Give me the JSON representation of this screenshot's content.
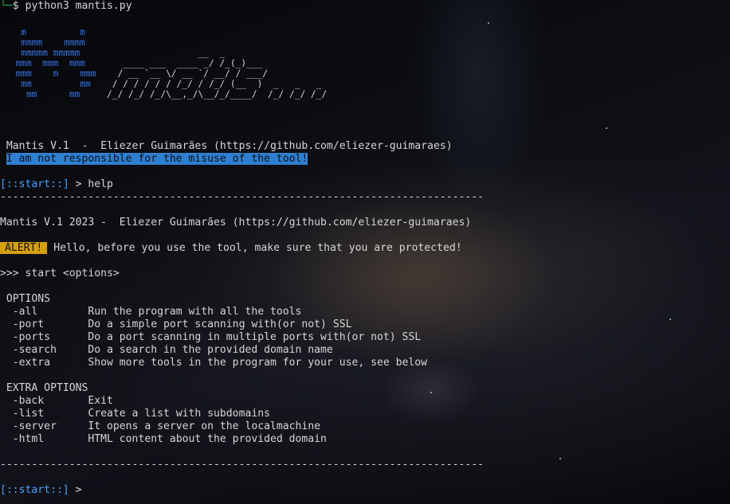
{
  "colors": {
    "background": "#07090d",
    "text": "#d6d6d6",
    "prompt_accent": "#3aa34a",
    "prompt_bracket": "#4a9eff",
    "disclaimer_highlight": "#2f7fd0",
    "alert_badge": "#d4a012",
    "logo_blue": "#3a70e0"
  },
  "command": {
    "prefix": "$ ",
    "text": "python3 mantis.py"
  },
  "banner": {
    "logo_rows": [
      "   m          m",
      "   mmmm    mmmm",
      "   mmmmm mmmmm",
      "  mmm  mmm  mmm",
      "  mmm    m    mmm",
      "   mm         mm",
      "    mm      mm"
    ],
    "text_rows": [
      "",
      "",
      "                 __  _",
      "   ____ ___  ____ _/ /_(_)___",
      "  / __ `__ \\/ __ `/ __/ / ___/",
      " / / / / / / /_/ / /_/ (__  )  _   _   _",
      "/_/ /_/ /_/\\__,_/\\__/_/____/  /_/ /_/ /_/"
    ]
  },
  "header": {
    "version_line": "Mantis V.1  -  Eliezer Guimarães (https://github.com/eliezer-guimaraes)",
    "disclaimer": "I am not responsible for the misuse of the tool!"
  },
  "session": {
    "prompt_label": "[::start::]",
    "prompt_arrow": " > ",
    "entered_command": "help",
    "separator": "-----------------------------------------------------------------------------",
    "title_line": "Mantis V.1 2023 -  Eliezer Guimarães (https://github.com/eliezer-guimaraes)",
    "alert_label": "ALERT!",
    "alert_message": " Hello, before you use the tool, make sure that you are protected!",
    "usage": ">>> start <options>",
    "options_title": " OPTIONS",
    "options": [
      {
        "flag": "  -all",
        "desc": "Run the program with all the tools"
      },
      {
        "flag": "  -port",
        "desc": "Do a simple port scanning with(or not) SSL"
      },
      {
        "flag": "  -ports",
        "desc": "Do a port scanning in multiple ports with(or not) SSL"
      },
      {
        "flag": "  -search",
        "desc": "Do a search in the provided domain name"
      },
      {
        "flag": "  -extra",
        "desc": "Show more tools in the program for your use, see below"
      }
    ],
    "extra_title": " EXTRA OPTIONS",
    "extra_options": [
      {
        "flag": "  -back",
        "desc": "Exit"
      },
      {
        "flag": "  -list",
        "desc": "Create a list with subdomains"
      },
      {
        "flag": "  -server",
        "desc": "It opens a server on the localmachine"
      },
      {
        "flag": "  -html",
        "desc": "HTML content about the provided domain"
      }
    ],
    "final_prompt_label": "[::start::]",
    "final_prompt_arrow": " > "
  }
}
